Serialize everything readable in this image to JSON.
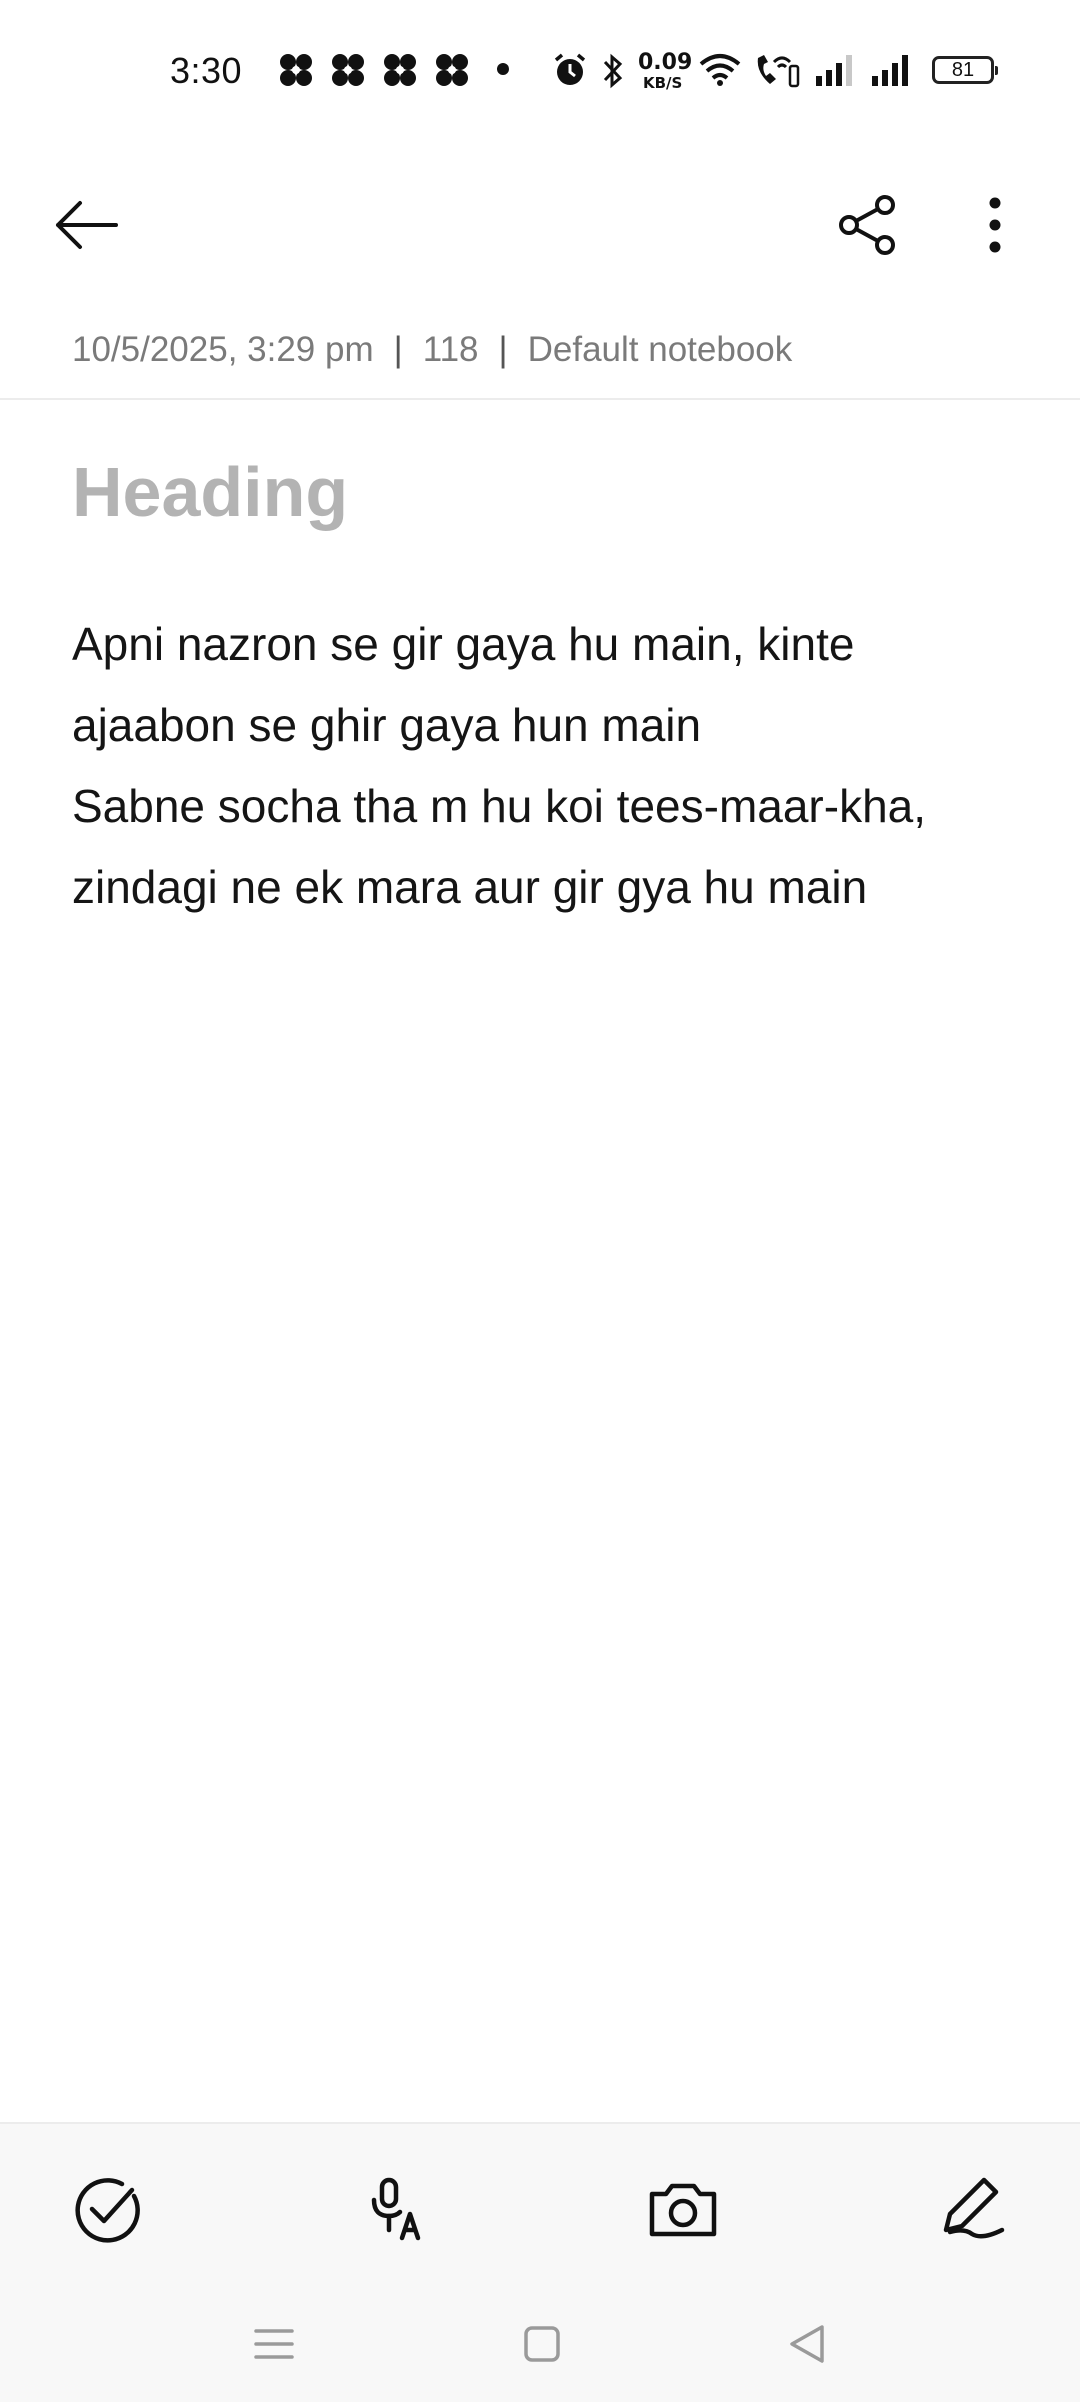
{
  "status_bar": {
    "time": "3:30",
    "net_speed_value": "0.09",
    "net_speed_unit": "KB/S",
    "battery": "81",
    "icons": [
      "pinwheel-icon",
      "pinwheel-icon",
      "pinwheel-icon",
      "pinwheel-icon",
      "dot-icon",
      "alarm-icon",
      "bluetooth-icon",
      "wifi-icon",
      "wifi-call-icon",
      "signal-icon",
      "signal-icon"
    ]
  },
  "app_bar": {
    "back_icon": "arrow-left-icon",
    "share_icon": "share-icon",
    "more_icon": "more-vertical-icon"
  },
  "meta": {
    "date": "10/5/2025, 3:29 pm",
    "char_count": "118",
    "notebook": "Default notebook",
    "separator": "|"
  },
  "editor": {
    "heading_placeholder": "Heading",
    "lines": [
      "Apni nazron se gir gaya hu main, kinte",
      "ajaabon se ghir gaya hun main",
      "Sabne socha tha m hu koi tees-maar-kha,",
      "zindagi ne ek mara aur gir gya hu main"
    ]
  },
  "toolbar": {
    "items": [
      "checklist-icon",
      "voice-to-text-icon",
      "camera-icon",
      "pen-icon"
    ]
  },
  "nav_bar": {
    "items": [
      "menu-icon",
      "home-icon",
      "back-triangle-icon"
    ]
  },
  "colors": {
    "background": "#ffffff",
    "meta_text": "#7a7a7a",
    "heading_placeholder": "#b3b3b3",
    "body_text": "#151515",
    "toolbar_bg": "#f8f8f8",
    "nav_icon": "#9a9a9a"
  }
}
